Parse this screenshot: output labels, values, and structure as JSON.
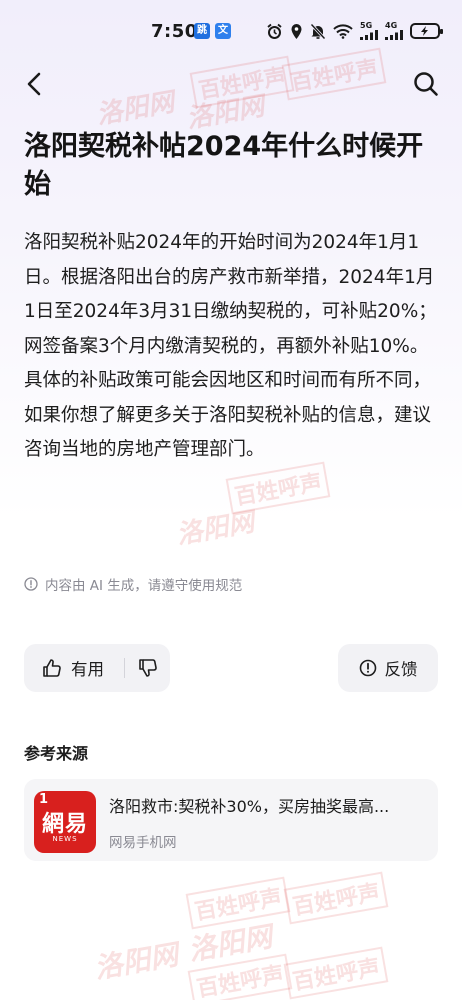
{
  "status_bar": {
    "time": "7:50",
    "app_badges": [
      "跳",
      "文"
    ],
    "net_tags": [
      "5G",
      "4G"
    ]
  },
  "nav": {
    "back_icon": "chevron-left-icon",
    "search_icon": "search-icon"
  },
  "title": "洛阳契税补帖2024年什么时候开始",
  "answer": {
    "paragraphs": [
      "洛阳契税补贴2024年的开始时间为2024年1月1日。根据洛阳出台的房产救市新举措，2024年1月1日至2024年3月31日缴纳契税的，可补贴20%；网签备案3个月内缴清契税的，再额外补贴10%。",
      "具体的补贴政策可能会因地区和时间而有所不同，如果你想了解更多关于洛阳契税补贴的信息，建议咨询当地的房地产管理部门。"
    ]
  },
  "ai_notice": "内容由 AI 生成，请遵守使用规范",
  "actions": {
    "useful_label": "有用",
    "report_label": "反馈"
  },
  "references": {
    "heading": "参考来源",
    "items": [
      {
        "title": "洛阳救市:契税补30%，买房抽奖最高...",
        "source": "网易手机网",
        "logo_text": "網易",
        "logo_sub": "NEWS",
        "index": "1"
      }
    ]
  },
  "watermark": {
    "text_a": "洛阳网",
    "text_b": "百姓呼声"
  },
  "colors": {
    "logo_red": "#d8201e",
    "watermark": "#dc4646"
  }
}
